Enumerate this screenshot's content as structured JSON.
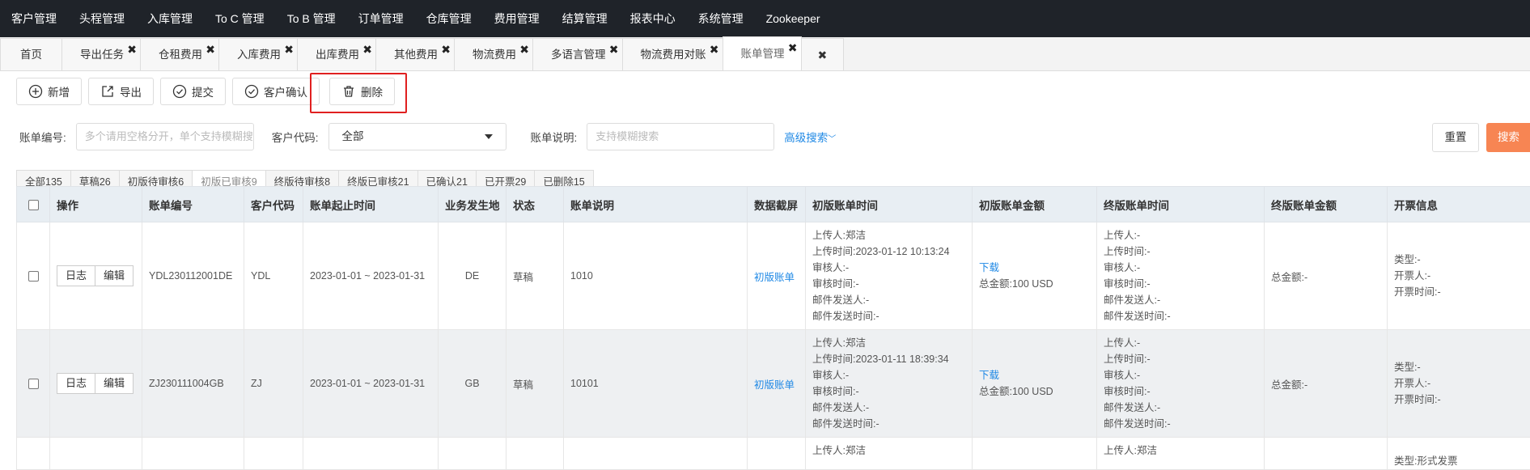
{
  "nav": [
    "客户管理",
    "头程管理",
    "入库管理",
    "To C 管理",
    "To B 管理",
    "订单管理",
    "仓库管理",
    "费用管理",
    "结算管理",
    "报表中心",
    "系统管理",
    "Zookeeper"
  ],
  "tabs": [
    {
      "label": "首页",
      "close": false
    },
    {
      "label": "导出任务",
      "close": true
    },
    {
      "label": "仓租费用",
      "close": true
    },
    {
      "label": "入库费用",
      "close": true
    },
    {
      "label": "出库费用",
      "close": true
    },
    {
      "label": "其他费用",
      "close": true
    },
    {
      "label": "物流费用",
      "close": true
    },
    {
      "label": "多语言管理",
      "close": true
    },
    {
      "label": "物流费用对账",
      "close": true
    },
    {
      "label": "账单管理",
      "close": true,
      "active": true
    }
  ],
  "toolbar": {
    "add": "新增",
    "export": "导出",
    "submit": "提交",
    "confirm": "客户确认",
    "delete": "删除"
  },
  "filter": {
    "bill_no_label": "账单编号:",
    "bill_no_placeholder": "多个请用空格分开，单个支持模糊搜索",
    "customer_label": "客户代码:",
    "customer_value": "全部",
    "desc_label": "账单说明:",
    "desc_placeholder": "支持模糊搜索",
    "advanced": "高级搜索",
    "reset": "重置",
    "search": "搜索"
  },
  "status_tabs": [
    {
      "label": "全部135"
    },
    {
      "label": "草稿26"
    },
    {
      "label": "初版待审核6"
    },
    {
      "label": "初版已审核9",
      "active": true
    },
    {
      "label": "终版待审核8"
    },
    {
      "label": "终版已审核21"
    },
    {
      "label": "已确认21"
    },
    {
      "label": "已开票29"
    },
    {
      "label": "已删除15"
    }
  ],
  "columns": [
    "操作",
    "账单编号",
    "客户代码",
    "账单起止时间",
    "业务发生地",
    "状态",
    "账单说明",
    "数据截屏",
    "初版账单时间",
    "初版账单金额",
    "终版账单时间",
    "终版账单金额",
    "开票信息"
  ],
  "row_ops": {
    "log": "日志",
    "edit": "编辑"
  },
  "rows": [
    {
      "bill_no": "YDL230112001DE",
      "customer": "YDL",
      "period": "2023-01-01 ~ 2023-01-31",
      "location": "DE",
      "status": "草稿",
      "desc": "1010",
      "snapshot": "初版账单",
      "first_time": [
        "上传人:郑洁",
        "上传时间:2023-01-12 10:13:24",
        "审核人:-",
        "审核时间:-",
        "邮件发送人:-",
        "邮件发送时间:-"
      ],
      "first_amount_link": "下载",
      "first_amount": "总金额:100 USD",
      "final_time": [
        "上传人:-",
        "上传时间:-",
        "审核人:-",
        "审核时间:-",
        "邮件发送人:-",
        "邮件发送时间:-"
      ],
      "final_amount": "总金额:-",
      "invoice": [
        "类型:-",
        "开票人:-",
        "开票时间:-"
      ]
    },
    {
      "bill_no": "ZJ230111004GB",
      "customer": "ZJ",
      "period": "2023-01-01 ~ 2023-01-31",
      "location": "GB",
      "status": "草稿",
      "desc": "10101",
      "snapshot": "初版账单",
      "first_time": [
        "上传人:郑洁",
        "上传时间:2023-01-11 18:39:34",
        "审核人:-",
        "审核时间:-",
        "邮件发送人:-",
        "邮件发送时间:-"
      ],
      "first_amount_link": "下载",
      "first_amount": "总金额:100 USD",
      "final_time": [
        "上传人:-",
        "上传时间:-",
        "审核人:-",
        "审核时间:-",
        "邮件发送人:-",
        "邮件发送时间:-"
      ],
      "final_amount": "总金额:-",
      "invoice": [
        "类型:-",
        "开票人:-",
        "开票时间:-"
      ]
    }
  ],
  "row3": {
    "first_uploader": "上传人:郑洁",
    "final_uploader": "上传人:郑洁",
    "invoice_type": "类型:形式发票"
  },
  "colors": {
    "nav_bg": "#1f2329",
    "accent": "#1e88e5",
    "search_btn": "#f78553",
    "highlight": "#e02020"
  }
}
